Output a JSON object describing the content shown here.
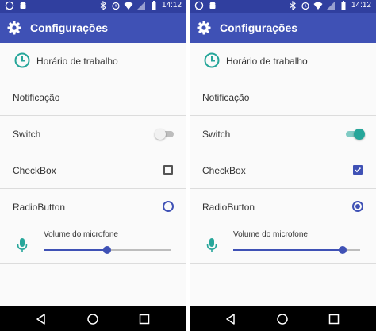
{
  "status_bar": {
    "time": "14:12"
  },
  "screens": [
    {
      "app_title": "Configurações",
      "rows": {
        "work_hours": "Horário de trabalho",
        "notification": "Notificação",
        "switch": {
          "label": "Switch",
          "checked": false
        },
        "checkbox": {
          "label": "CheckBox",
          "checked": false
        },
        "radio": {
          "label": "RadioButton",
          "checked": false
        },
        "volume": {
          "label": "Volume do microfone",
          "value_fraction": 0.5
        }
      }
    },
    {
      "app_title": "Configurações",
      "rows": {
        "work_hours": "Horário de trabalho",
        "notification": "Notificação",
        "switch": {
          "label": "Switch",
          "checked": true
        },
        "checkbox": {
          "label": "CheckBox",
          "checked": true
        },
        "radio": {
          "label": "RadioButton",
          "checked": true
        },
        "volume": {
          "label": "Volume do microfone",
          "value_fraction": 0.86
        }
      }
    }
  ],
  "colors": {
    "primary": "#3f51b5",
    "primary_dark": "#303f9f",
    "teal_accent": "#26a69a",
    "switch_track_on": "#80cbc4",
    "switch_track_off": "#bdbdbd",
    "switch_thumb_off": "#f1f1f1"
  },
  "icons": {
    "app_bar": "gear-icon",
    "work_hours": "clock-icon",
    "volume": "microphone-icon",
    "status_left": [
      "whatsapp-icon",
      "android-icon"
    ],
    "status_right": [
      "bluetooth-icon",
      "alarm-icon",
      "wifi-icon",
      "signal-icon",
      "battery-icon"
    ],
    "nav": [
      "back-icon",
      "home-icon",
      "recents-icon"
    ]
  }
}
